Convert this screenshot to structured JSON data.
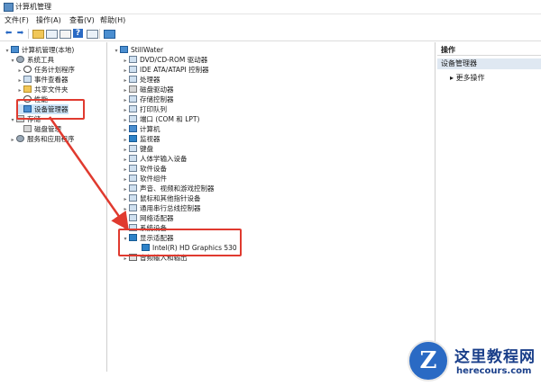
{
  "window": {
    "title": "计算机管理"
  },
  "menu": [
    "文件(F)",
    "操作(A)",
    "查看(V)",
    "帮助(H)"
  ],
  "left_tree": [
    {
      "label": "计算机管理(本地)",
      "expander": "▾",
      "icon": "computer-icon"
    },
    {
      "label": "系统工具",
      "expander": "▾",
      "icon": "tools-icon"
    },
    {
      "label": "任务计划程序",
      "expander": "▸",
      "icon": "clock-icon"
    },
    {
      "label": "事件查看器",
      "expander": "▸",
      "icon": "event-viewer-icon"
    },
    {
      "label": "共享文件夹",
      "expander": "▸",
      "icon": "shared-folder-icon"
    },
    {
      "label": "性能",
      "expander": "▸",
      "icon": "performance-icon"
    },
    {
      "label": "设备管理器",
      "expander": "",
      "icon": "device-manager-icon"
    },
    {
      "label": "存储",
      "expander": "▾",
      "icon": "storage-icon"
    },
    {
      "label": "磁盘管理",
      "expander": "",
      "icon": "disk-icon"
    },
    {
      "label": "服务和应用程序",
      "expander": "▸",
      "icon": "services-icon"
    }
  ],
  "device_tree": {
    "root": "StillWater",
    "items": [
      {
        "label": "DVD/CD-ROM 驱动器",
        "icon": "dvd-drive-icon"
      },
      {
        "label": "IDE ATA/ATAPI 控制器",
        "icon": "ide-controller-icon"
      },
      {
        "label": "处理器",
        "icon": "processor-icon"
      },
      {
        "label": "磁盘驱动器",
        "icon": "disk-drive-icon"
      },
      {
        "label": "存储控制器",
        "icon": "storage-controller-icon"
      },
      {
        "label": "打印队列",
        "icon": "printer-icon"
      },
      {
        "label": "端口 (COM 和 LPT)",
        "icon": "port-icon"
      },
      {
        "label": "计算机",
        "icon": "computer-icon"
      },
      {
        "label": "监视器",
        "icon": "monitor-icon"
      },
      {
        "label": "键盘",
        "icon": "keyboard-icon"
      },
      {
        "label": "人体学输入设备",
        "icon": "hid-icon"
      },
      {
        "label": "软件设备",
        "icon": "software-device-icon"
      },
      {
        "label": "软件组件",
        "icon": "software-component-icon"
      },
      {
        "label": "声音、视频和游戏控制器",
        "icon": "sound-icon"
      },
      {
        "label": "鼠标和其他指针设备",
        "icon": "mouse-icon"
      },
      {
        "label": "通用串行总线控制器",
        "icon": "usb-icon"
      },
      {
        "label": "网络适配器",
        "icon": "network-adapter-icon"
      },
      {
        "label": "系统设备",
        "icon": "system-device-icon"
      },
      {
        "label": "显示适配器",
        "icon": "display-adapter-icon",
        "expanded": true
      },
      {
        "label": "Intel(R) HD Graphics 530",
        "icon": "display-adapter-icon",
        "child": true
      },
      {
        "label": "音频输入和输出",
        "icon": "audio-io-icon"
      }
    ]
  },
  "actions": {
    "header": "操作",
    "section": "设备管理器",
    "more": "更多操作"
  },
  "watermark": {
    "cn": "这里教程网",
    "en": "herecours.com",
    "logo_letter": "Z"
  },
  "colors": {
    "highlight": "#e03a2f",
    "selection": "#cce4f7",
    "accent": "#2a6ac4"
  }
}
